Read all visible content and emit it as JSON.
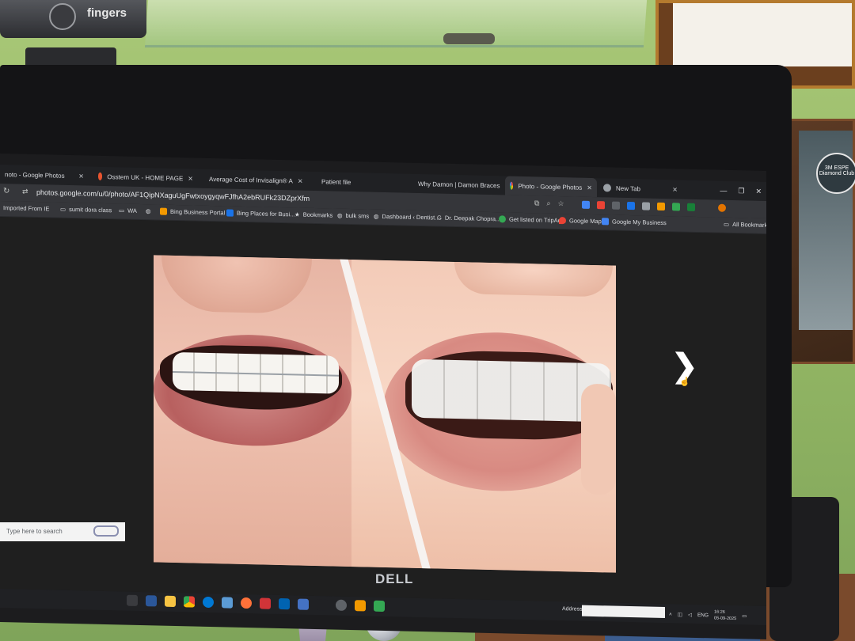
{
  "device": {
    "brand_logo": "fingers",
    "monitor_brand": "DELL"
  },
  "poster": {
    "badge_text": "3M ESPE Diamond Club"
  },
  "browser": {
    "tabs": [
      {
        "title": "noto - Google Photos",
        "active": false
      },
      {
        "title": "Osstem UK - HOME PAGE",
        "active": false
      },
      {
        "title": "Average Cost of Invisalign® A",
        "active": false
      },
      {
        "title": "Patient file",
        "active": false
      },
      {
        "title": "Why Damon | Damon Braces",
        "active": false
      },
      {
        "title": "Photo - Google Photos",
        "active": true
      },
      {
        "title": "New Tab",
        "active": false
      }
    ],
    "url": "photos.google.com/u/0/photo/AF1QipNXaguUgFwtxoygyqwFJfhA2ebRUFk23DZprXfm",
    "bookmarks": [
      {
        "label": "Imported From IE",
        "icon": "folder-icon"
      },
      {
        "label": "sumit dora class",
        "icon": "folder-icon"
      },
      {
        "label": "WA",
        "icon": "folder-icon"
      },
      {
        "label": "",
        "icon": "globe-icon"
      },
      {
        "label": "Bing Business Portal",
        "icon": "bing-icon"
      },
      {
        "label": "Bing Places for Busi...",
        "icon": "bing-icon"
      },
      {
        "label": "Bookmarks",
        "icon": "star-icon"
      },
      {
        "label": "bulk sms",
        "icon": "globe-icon"
      },
      {
        "label": "Dashboard ‹ Dentist...",
        "icon": "globe-icon"
      },
      {
        "label": "Dr. Deepak Chopra...",
        "icon": "google-icon"
      },
      {
        "label": "Get listed on TripAd...",
        "icon": "tripadvisor-icon"
      },
      {
        "label": "Google Maps",
        "icon": "maps-icon"
      },
      {
        "label": "Google My Business",
        "icon": "business-icon"
      }
    ],
    "all_bookmarks": "All Bookmarks"
  },
  "photo": {
    "next_label": "❯"
  },
  "taskbar": {
    "search_placeholder": "Type here to search",
    "address_label": "Address",
    "lang": "ENG",
    "time": "16:26",
    "date": "05-09-2025"
  },
  "colors": {
    "tab_bg": "#202124",
    "toolbar_bg": "#35363a",
    "content_bg": "#1f1f1f"
  }
}
